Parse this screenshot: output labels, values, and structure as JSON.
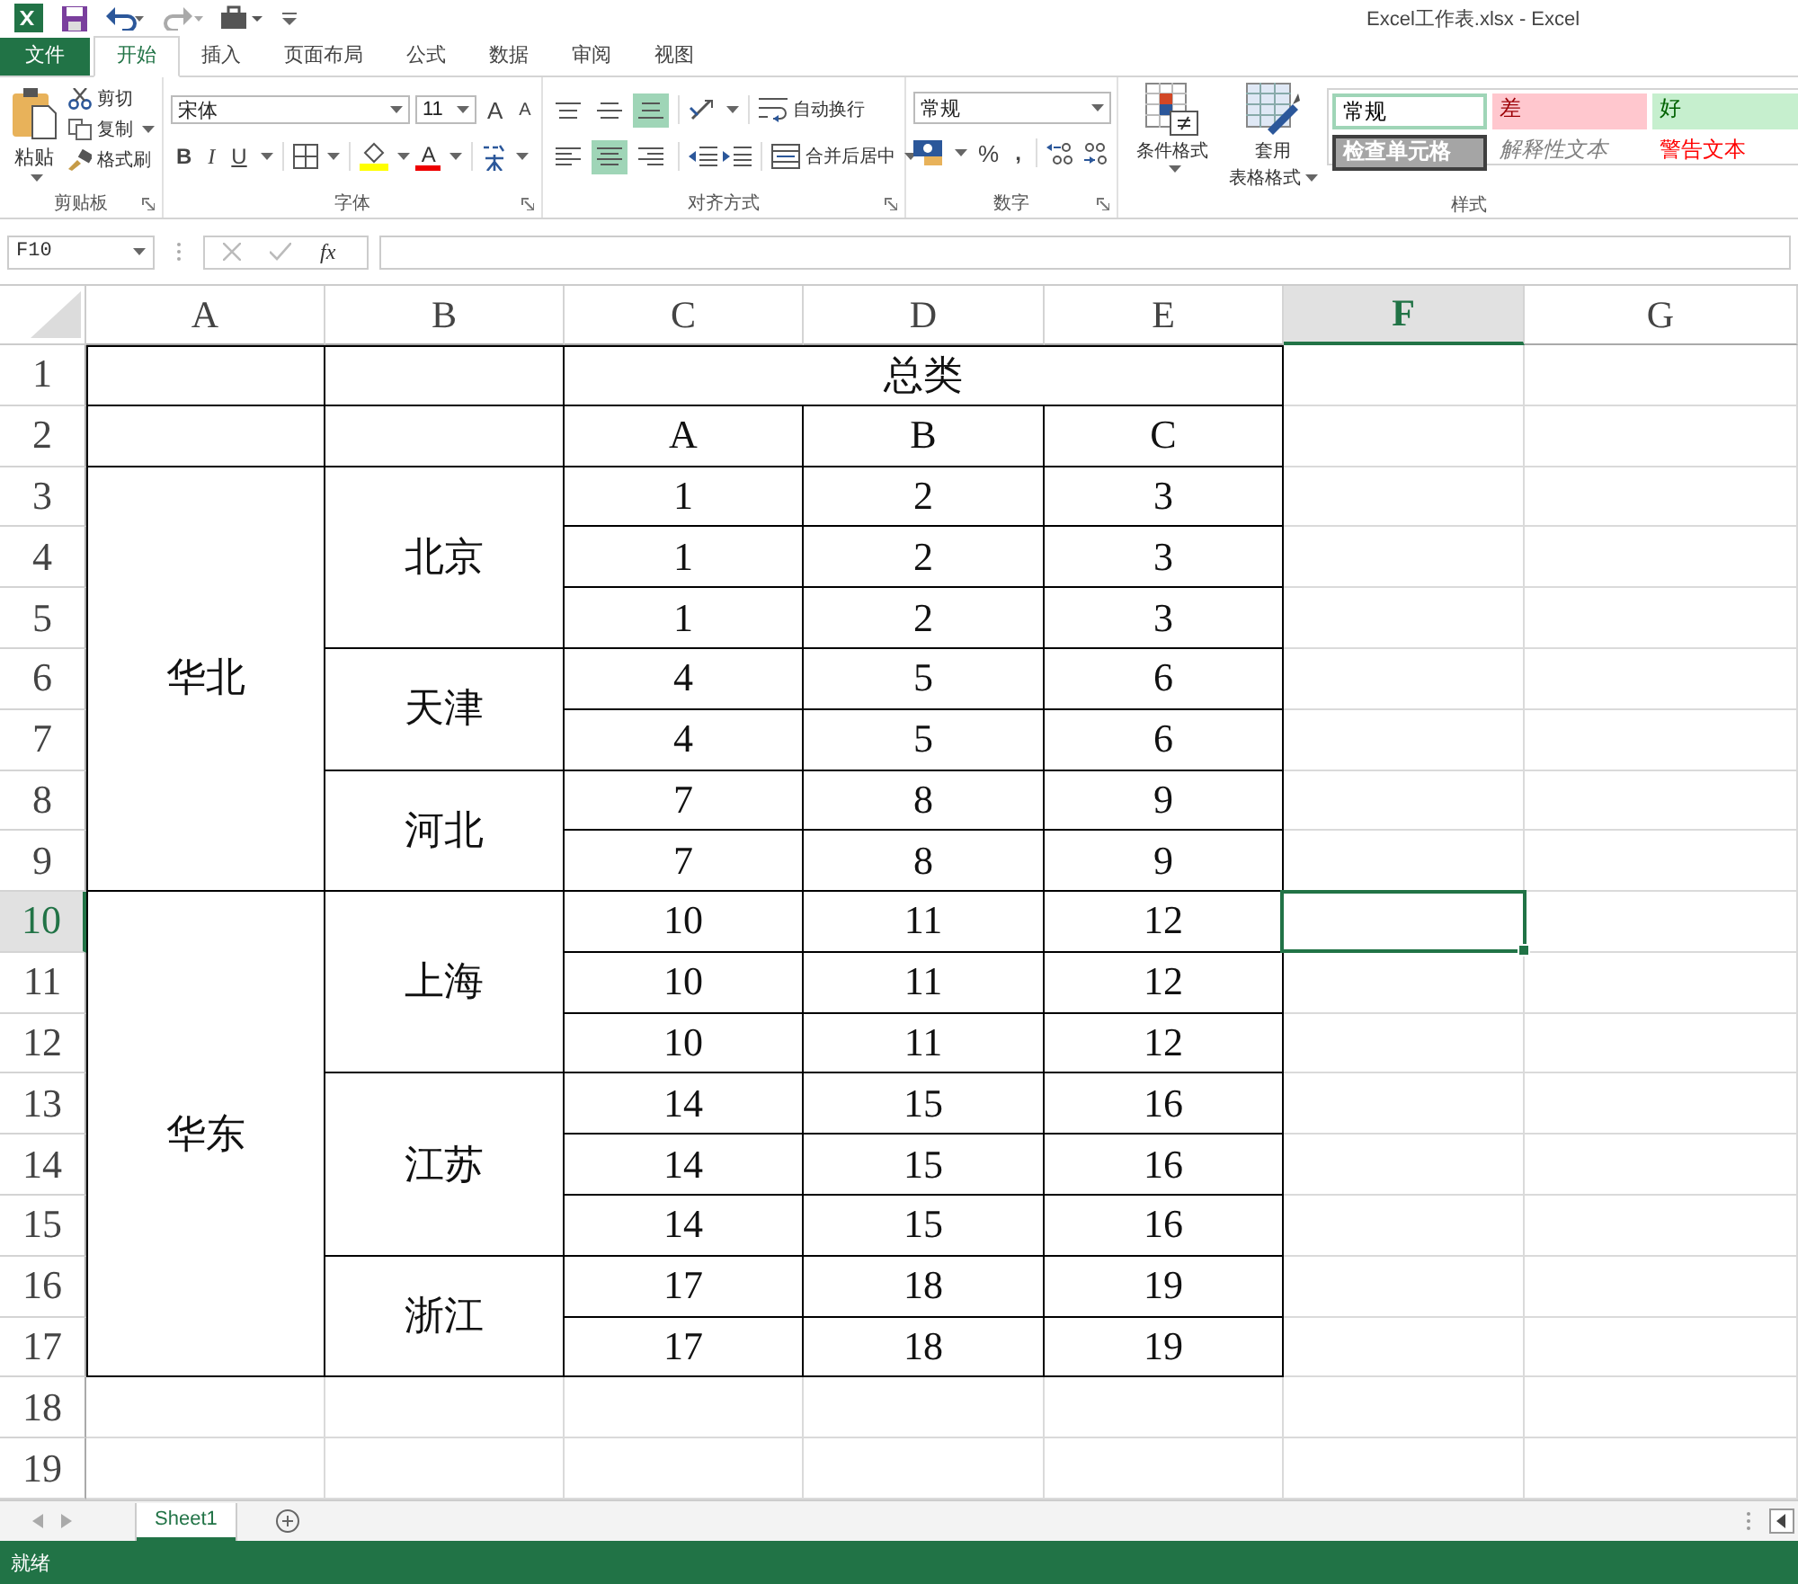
{
  "window": {
    "title": "Excel工作表.xlsx - Excel"
  },
  "tabs": [
    {
      "label": "文件",
      "kind": "file",
      "selected": false
    },
    {
      "label": "开始",
      "kind": "tab",
      "selected": true
    },
    {
      "label": "插入",
      "kind": "tab",
      "selected": false
    },
    {
      "label": "页面布局",
      "kind": "tab",
      "selected": false
    },
    {
      "label": "公式",
      "kind": "tab",
      "selected": false
    },
    {
      "label": "数据",
      "kind": "tab",
      "selected": false
    },
    {
      "label": "审阅",
      "kind": "tab",
      "selected": false
    },
    {
      "label": "视图",
      "kind": "tab",
      "selected": false
    }
  ],
  "ribbon": {
    "clipboard": {
      "label": "剪贴板",
      "paste": "粘贴",
      "cut": "剪切",
      "copy": "复制",
      "painter": "格式刷"
    },
    "font": {
      "label": "字体",
      "name": "宋体",
      "size": "11",
      "grow": "A",
      "shrink": "A",
      "bold": "B",
      "italic": "I",
      "underline": "U",
      "color_letter": "A"
    },
    "alignment": {
      "label": "对齐方式",
      "vertical": [
        {
          "selected": false
        },
        {
          "selected": false
        },
        {
          "selected": true
        }
      ],
      "horizontal": [
        {
          "selected": false
        },
        {
          "selected": true
        },
        {
          "selected": false
        }
      ],
      "wrap": "自动换行",
      "merge": "合并后居中"
    },
    "number": {
      "label": "数字",
      "format": "常规",
      "percent": "%",
      "comma": ","
    },
    "styles": {
      "label": "样式",
      "conditional": "条件格式",
      "table_format": [
        "套用",
        "表格格式"
      ],
      "gallery": [
        {
          "label": "常规",
          "kind": "normal"
        },
        {
          "label": "差",
          "kind": "bad"
        },
        {
          "label": "好",
          "kind": "good"
        },
        {
          "label": "检查单元格",
          "kind": "check"
        },
        {
          "label": "解释性文本",
          "kind": "explanatory"
        },
        {
          "label": "警告文本",
          "kind": "warning"
        }
      ]
    }
  },
  "formula_bar": {
    "name_box": "F10",
    "function_label": "fx"
  },
  "columns": [
    {
      "label": "A",
      "selected": false
    },
    {
      "label": "B",
      "selected": false
    },
    {
      "label": "C",
      "selected": false
    },
    {
      "label": "D",
      "selected": false
    },
    {
      "label": "E",
      "selected": false
    },
    {
      "label": "F",
      "selected": true
    },
    {
      "label": "G",
      "selected": false
    }
  ],
  "rows": [
    {
      "label": "1",
      "selected": false
    },
    {
      "label": "2",
      "selected": false
    },
    {
      "label": "3",
      "selected": false
    },
    {
      "label": "4",
      "selected": false
    },
    {
      "label": "5",
      "selected": false
    },
    {
      "label": "6",
      "selected": false
    },
    {
      "label": "7",
      "selected": false
    },
    {
      "label": "8",
      "selected": false
    },
    {
      "label": "9",
      "selected": false
    },
    {
      "label": "10",
      "selected": true
    },
    {
      "label": "11",
      "selected": false
    },
    {
      "label": "12",
      "selected": false
    },
    {
      "label": "13",
      "selected": false
    },
    {
      "label": "14",
      "selected": false
    },
    {
      "label": "15",
      "selected": false
    },
    {
      "label": "16",
      "selected": false
    },
    {
      "label": "17",
      "selected": false
    },
    {
      "label": "18",
      "selected": false
    },
    {
      "label": "19",
      "selected": false
    }
  ],
  "table": {
    "title": "总类",
    "columns": [
      "A",
      "B",
      "C"
    ],
    "regions": [
      {
        "name": "华北",
        "cities": [
          {
            "name": "北京",
            "rows": [
              [
                "1",
                "2",
                "3"
              ],
              [
                "1",
                "2",
                "3"
              ],
              [
                "1",
                "2",
                "3"
              ]
            ]
          },
          {
            "name": "天津",
            "rows": [
              [
                "4",
                "5",
                "6"
              ],
              [
                "4",
                "5",
                "6"
              ]
            ]
          },
          {
            "name": "河北",
            "rows": [
              [
                "7",
                "8",
                "9"
              ],
              [
                "7",
                "8",
                "9"
              ]
            ]
          }
        ]
      },
      {
        "name": "华东",
        "cities": [
          {
            "name": "上海",
            "rows": [
              [
                "10",
                "11",
                "12"
              ],
              [
                "10",
                "11",
                "12"
              ],
              [
                "10",
                "11",
                "12"
              ]
            ]
          },
          {
            "name": "江苏",
            "rows": [
              [
                "14",
                "15",
                "16"
              ],
              [
                "14",
                "15",
                "16"
              ],
              [
                "14",
                "15",
                "16"
              ]
            ]
          },
          {
            "name": "浙江",
            "rows": [
              [
                "17",
                "18",
                "19"
              ],
              [
                "17",
                "18",
                "19"
              ]
            ]
          }
        ]
      }
    ]
  },
  "sheet_tabs": [
    {
      "label": "Sheet1",
      "selected": true
    }
  ],
  "status_bar": {
    "text": "就绪"
  }
}
